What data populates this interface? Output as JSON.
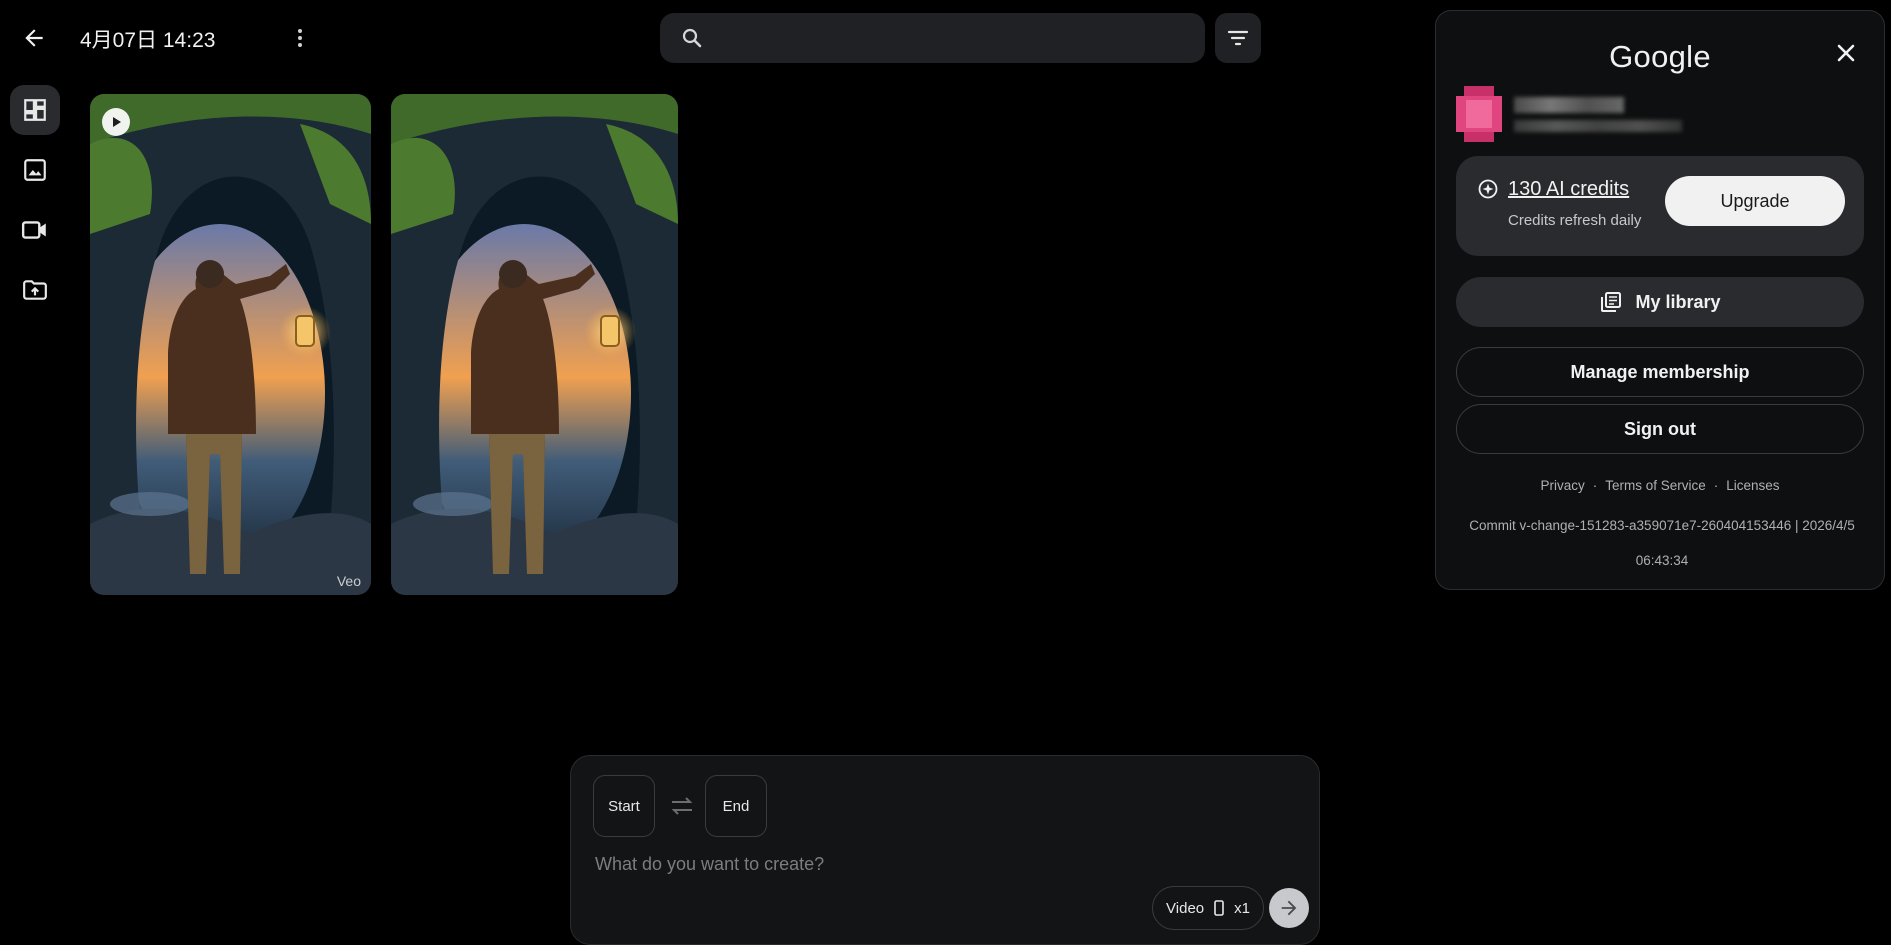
{
  "header": {
    "title": "4月07日 14:23",
    "search_placeholder": ""
  },
  "gallery": {
    "items": [
      {
        "kind": "video",
        "badge": "Veo"
      },
      {
        "kind": "video",
        "badge": ""
      }
    ]
  },
  "composer": {
    "start_label": "Start",
    "end_label": "End",
    "prompt_placeholder": "What do you want to create?",
    "mode_label": "Video",
    "count_label": "x1"
  },
  "account": {
    "brand": "Google",
    "credits_label": "130 AI credits",
    "credits_sub": "Credits refresh daily",
    "upgrade_label": "Upgrade",
    "library_label": "My library",
    "manage_label": "Manage membership",
    "signout_label": "Sign out",
    "footer": {
      "privacy": "Privacy",
      "terms": "Terms of Service",
      "licenses": "Licenses",
      "commit": "Commit v-change-151283-a359071e7-260404153446 | 2026/4/5 06:43:34"
    }
  },
  "colors": {
    "background": "#000000",
    "surface": "#202124",
    "panel": "#0e0f10",
    "card": "#2a2b2e",
    "avatar": "#e0457f"
  }
}
